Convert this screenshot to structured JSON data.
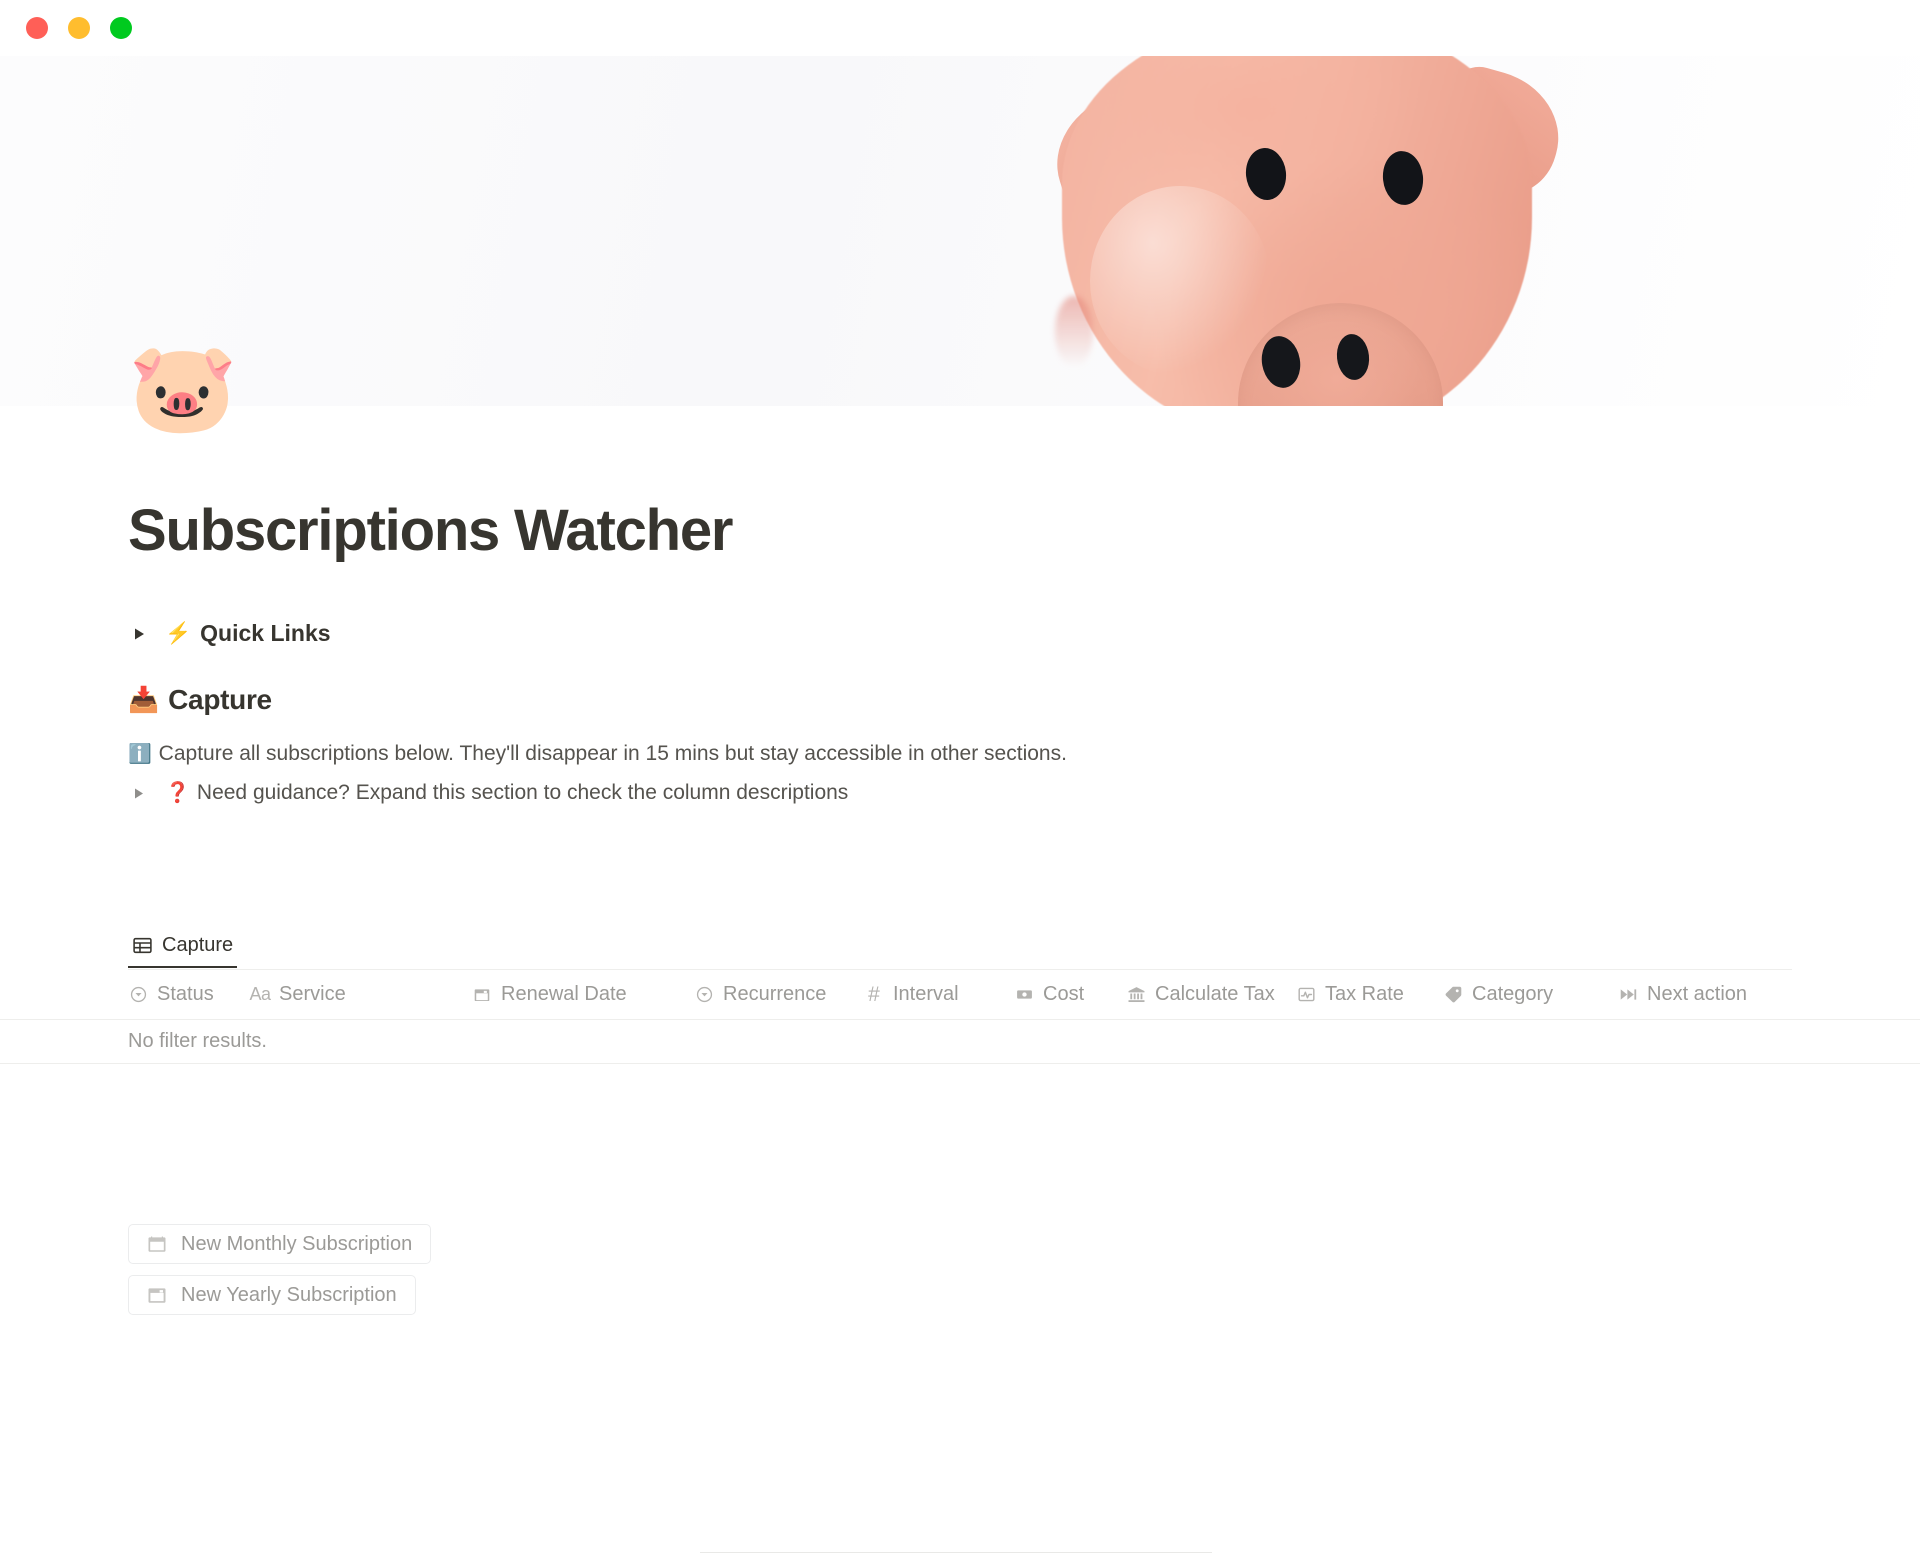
{
  "window": {
    "controls": [
      {
        "name": "close",
        "color": "#ff5f57"
      },
      {
        "name": "minimize",
        "color": "#ffbd2e"
      },
      {
        "name": "maximize",
        "color": "#00ca1f"
      }
    ]
  },
  "cover": {
    "description": "pink piggy bank close-up on white background"
  },
  "page": {
    "icon": "🐷",
    "title": "Subscriptions Watcher"
  },
  "quick_links": {
    "emoji": "⚡",
    "label": "Quick Links"
  },
  "capture_section": {
    "emoji": "📥",
    "heading": "Capture",
    "info_emoji": "ℹ️",
    "info_text": "Capture all subscriptions below. They'll disappear in 15 mins but stay accessible in other sections.",
    "guidance_mark": "❓",
    "guidance_text": "Need guidance? Expand this section to check the column descriptions"
  },
  "buttons": [
    {
      "id": "new-monthly",
      "icon": "calendar-grid-icon",
      "label": "New Monthly Subscription"
    },
    {
      "id": "new-yearly",
      "icon": "calendar-icon",
      "label": "New Yearly Subscription"
    }
  ],
  "database": {
    "tab": {
      "icon": "table-icon",
      "label": "Capture"
    },
    "columns": [
      {
        "id": "status",
        "icon": "select-icon",
        "label": "Status"
      },
      {
        "id": "service",
        "icon": "text-aa-icon",
        "label": "Service"
      },
      {
        "id": "renewal-date",
        "icon": "calendar-icon",
        "label": "Renewal Date"
      },
      {
        "id": "recurrence",
        "icon": "select-icon",
        "label": "Recurrence"
      },
      {
        "id": "interval",
        "icon": "number-hash-icon",
        "label": "Interval"
      },
      {
        "id": "cost",
        "icon": "money-icon",
        "label": "Cost"
      },
      {
        "id": "calc-tax",
        "icon": "bank-icon",
        "label": "Calculate Tax"
      },
      {
        "id": "tax-rate",
        "icon": "formula-icon",
        "label": "Tax Rate"
      },
      {
        "id": "category",
        "icon": "tag-icon",
        "label": "Category"
      },
      {
        "id": "next-action",
        "icon": "skip-forward-icon",
        "label": "Next action"
      }
    ],
    "empty_state": "No filter results.",
    "rows": []
  },
  "colors": {
    "text_primary": "#37352f",
    "text_secondary": "#55534e",
    "text_muted": "#9b9a97",
    "border": "#eeeeec",
    "accent_red": "#e03e3e"
  }
}
